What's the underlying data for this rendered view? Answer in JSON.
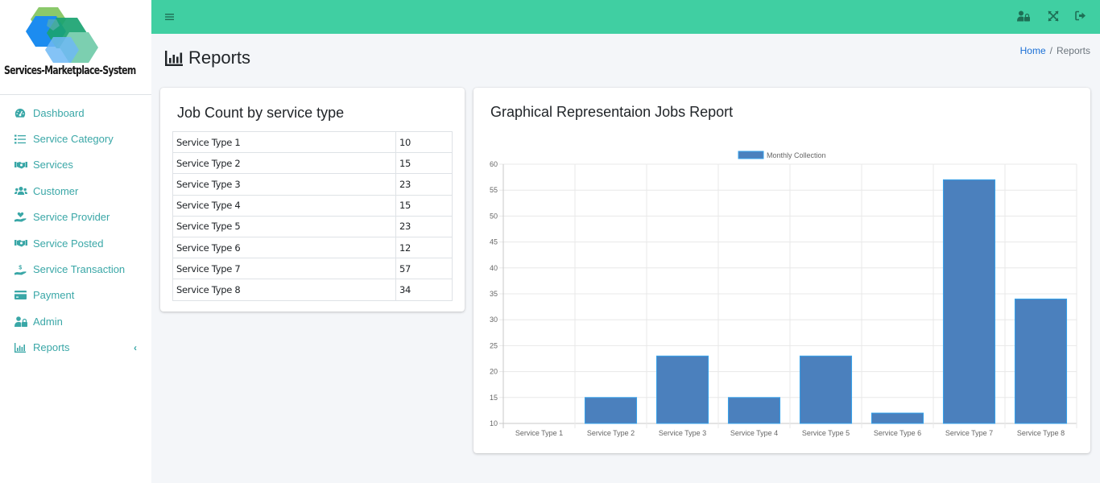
{
  "brand": {
    "name": "Services-Marketplace-System",
    "logo_icon": "hexagon-logo-icon"
  },
  "sidebar": {
    "items": [
      {
        "label": "Dashboard",
        "icon": "tachometer-icon"
      },
      {
        "label": "Service Category",
        "icon": "list-icon"
      },
      {
        "label": "Services",
        "icon": "handshake-icon"
      },
      {
        "label": "Customer",
        "icon": "users-icon"
      },
      {
        "label": "Service Provider",
        "icon": "hand-holding-heart-icon"
      },
      {
        "label": "Service Posted",
        "icon": "handshake-icon"
      },
      {
        "label": "Service Transaction",
        "icon": "hand-holding-usd-icon"
      },
      {
        "label": "Payment",
        "icon": "credit-card-icon"
      },
      {
        "label": "Admin",
        "icon": "user-lock-icon"
      },
      {
        "label": "Reports",
        "icon": "chart-bar-icon",
        "expand_icon": "chevron-left-icon"
      }
    ]
  },
  "topbar": {
    "menu_icon": "bars-icon",
    "right_icons": [
      "user-lock-icon",
      "expand-arrows-icon",
      "sign-out-icon"
    ]
  },
  "page": {
    "title": "Reports",
    "title_icon": "chart-bar-icon",
    "breadcrumb": [
      {
        "label": "Home",
        "link": true
      },
      {
        "label": "Reports",
        "link": false
      }
    ]
  },
  "job_count_card": {
    "title": "Job Count by service type",
    "rows": [
      {
        "type": "Service Type 1",
        "count": "10"
      },
      {
        "type": "Service Type 2",
        "count": "15"
      },
      {
        "type": "Service Type 3",
        "count": "23"
      },
      {
        "type": "Service Type 4",
        "count": "15"
      },
      {
        "type": "Service Type 5",
        "count": "23"
      },
      {
        "type": "Service Type 6",
        "count": "12"
      },
      {
        "type": "Service Type 7",
        "count": "57"
      },
      {
        "type": "Service Type 8",
        "count": "34"
      }
    ]
  },
  "chart_card": {
    "title": "Graphical Representaion Jobs Report"
  },
  "colors": {
    "accent": "#40cfa2",
    "sidebar_text": "#3aa7a7",
    "bar_fill": "#4b80bd",
    "bar_border": "#36a2eb",
    "link": "#1a6fd6"
  },
  "chart_data": {
    "type": "bar",
    "title": "",
    "categories": [
      "Service Type 1",
      "Service Type 2",
      "Service Type 3",
      "Service Type 4",
      "Service Type 5",
      "Service Type 6",
      "Service Type 7",
      "Service Type 8"
    ],
    "series": [
      {
        "name": "Monthly Collection",
        "values": [
          10,
          15,
          23,
          15,
          23,
          12,
          57,
          34
        ]
      }
    ],
    "xlabel": "",
    "ylabel": "",
    "ylim": [
      10,
      60
    ],
    "yticks": [
      10,
      15,
      20,
      25,
      30,
      35,
      40,
      45,
      50,
      55,
      60
    ],
    "grid": true,
    "legend": "top-center"
  }
}
